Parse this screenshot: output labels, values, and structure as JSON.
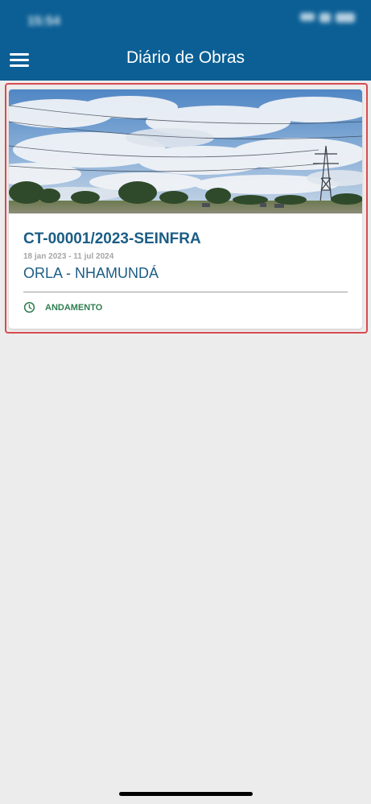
{
  "status_bar": {
    "time": "15:54"
  },
  "header": {
    "title": "Diário de Obras",
    "menu_icon": "menu-icon"
  },
  "card": {
    "contract_number": "CT-00001/2023-SEINFRA",
    "date_range": "18 jan 2023 - 11 jul 2024",
    "work_name": "ORLA - NHAMUNDÁ",
    "status": "ANDAMENTO",
    "status_icon": "clock-icon",
    "image": "construction-site-photo"
  },
  "colors": {
    "header": "#0b5f95",
    "primary_text": "#1b5d85",
    "status": "#2e7d4f",
    "highlight_border": "#d84b50",
    "background": "#ececec"
  }
}
